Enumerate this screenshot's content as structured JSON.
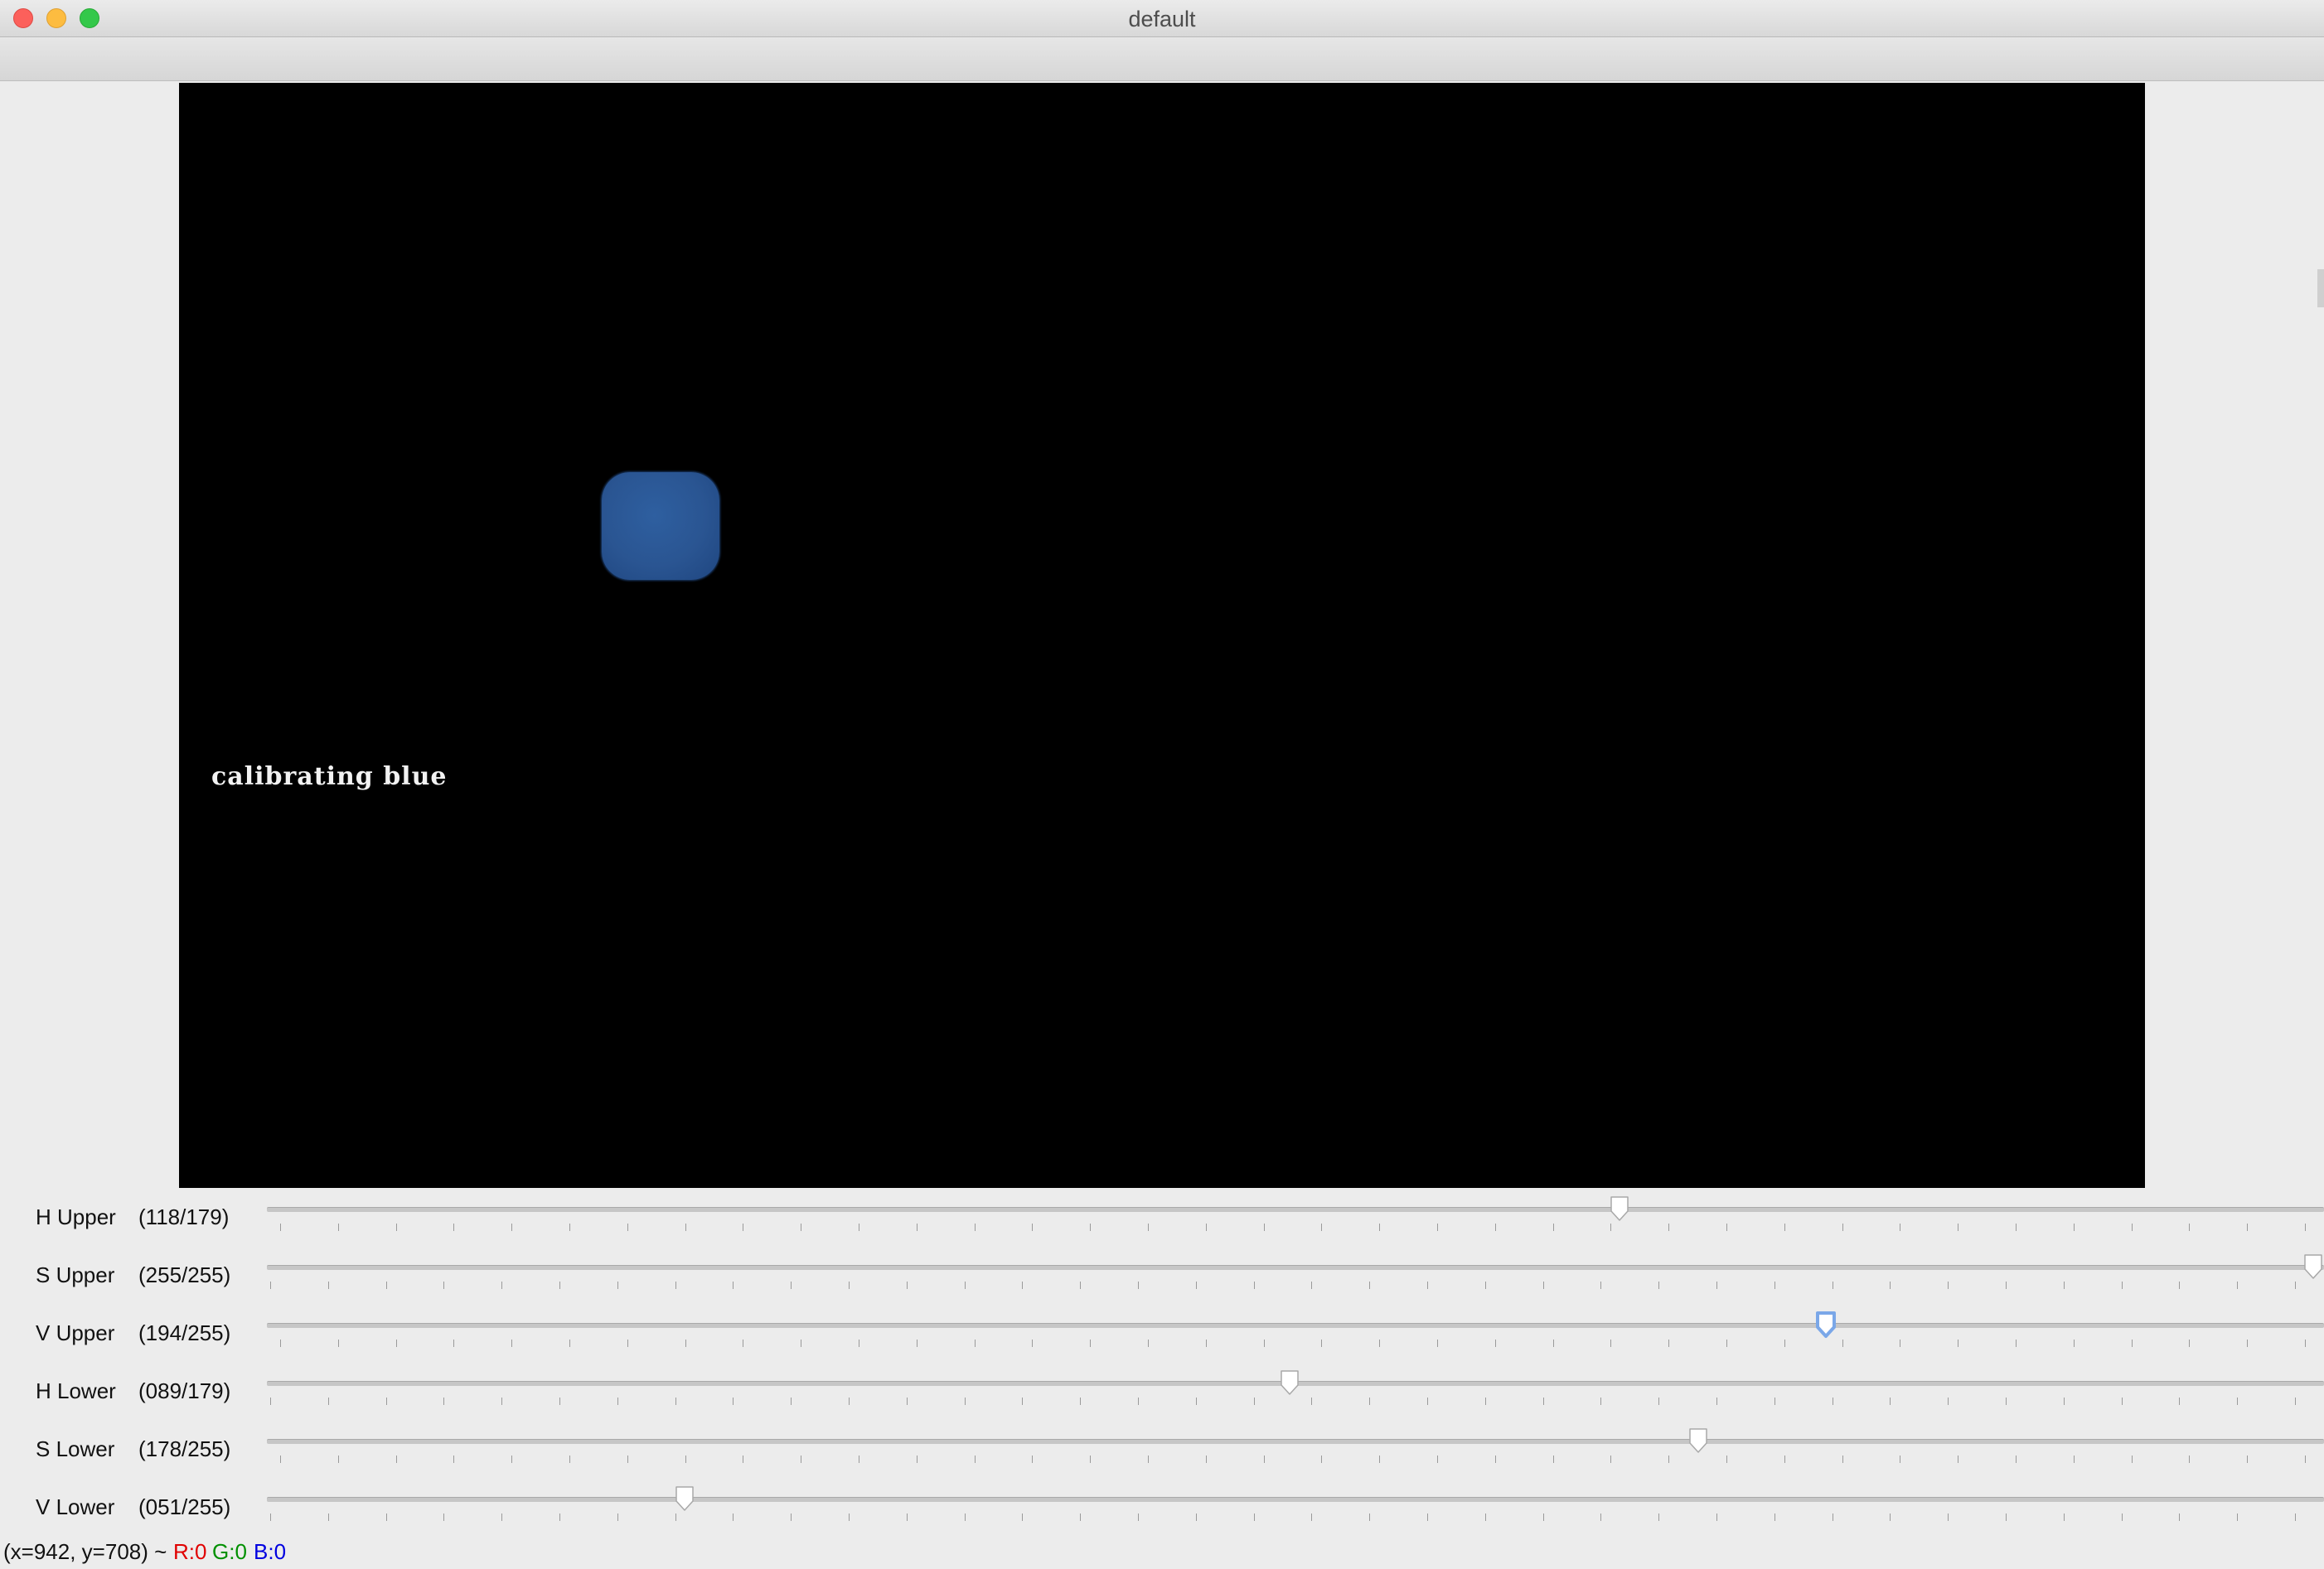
{
  "window": {
    "title": "default"
  },
  "image": {
    "overlay_text": "calibrating blue"
  },
  "sliders": [
    {
      "name": "H Upper",
      "value_label": "(118/179)",
      "value": 118,
      "max": 179,
      "focused": false
    },
    {
      "name": "S Upper",
      "value_label": "(255/255)",
      "value": 255,
      "max": 255,
      "focused": false
    },
    {
      "name": "V Upper",
      "value_label": "(194/255)",
      "value": 194,
      "max": 255,
      "focused": true
    },
    {
      "name": "H Lower",
      "value_label": "(089/179)",
      "value": 89,
      "max": 179,
      "focused": false
    },
    {
      "name": "S Lower",
      "value_label": "(178/255)",
      "value": 178,
      "max": 255,
      "focused": false
    },
    {
      "name": "V Lower",
      "value_label": "(051/255)",
      "value": 51,
      "max": 255,
      "focused": false
    }
  ],
  "status": {
    "coords": "(x=942, y=708) ~",
    "r": "R:0",
    "g": "G:0",
    "b": "B:0",
    "r_color": "#e00000",
    "g_color": "#009000",
    "b_color": "#0000e0"
  },
  "colors": {
    "blob": "#2a5592",
    "focus_ring": "#7aa7e8"
  }
}
